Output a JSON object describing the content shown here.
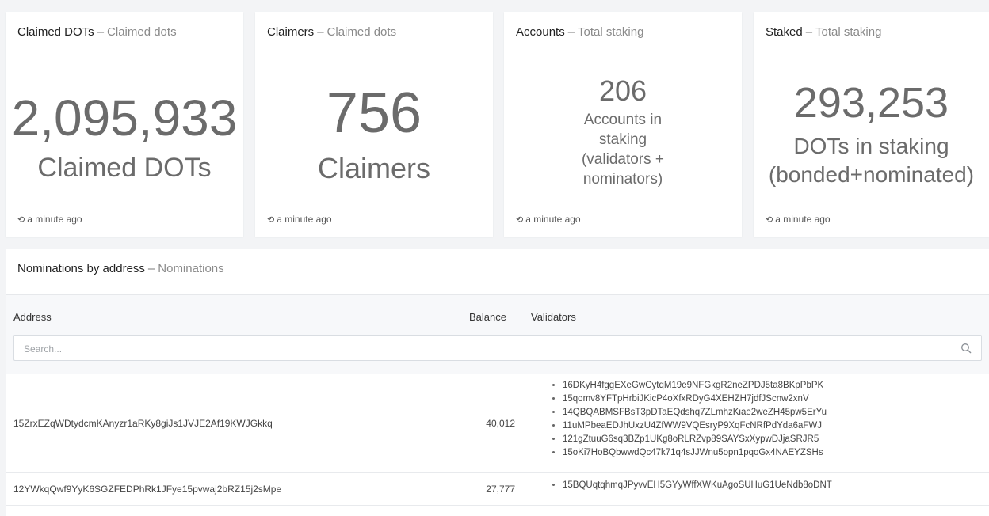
{
  "cards": [
    {
      "title": "Claimed DOTs",
      "subtitle": "Claimed dots",
      "value": "2,095,933",
      "label_lines": [
        "Claimed DOTs"
      ],
      "timestamp": "a minute ago"
    },
    {
      "title": "Claimers",
      "subtitle": "Claimed dots",
      "value": "756",
      "label_lines": [
        "Claimers"
      ],
      "timestamp": "a minute ago"
    },
    {
      "title": "Accounts",
      "subtitle": "Total staking",
      "value": "206",
      "label_lines": [
        "Accounts in",
        "staking",
        "(validators +",
        "nominators)"
      ],
      "timestamp": "a minute ago"
    },
    {
      "title": "Staked",
      "subtitle": "Total staking",
      "value": "293,253",
      "label_lines": [
        "DOTs in staking",
        "(bonded+nominated)"
      ],
      "timestamp": "a minute ago"
    }
  ],
  "nominations": {
    "title": "Nominations by address",
    "subtitle": "Nominations",
    "columns": {
      "address": "Address",
      "balance": "Balance",
      "validators": "Validators"
    },
    "search_placeholder": "Search...",
    "rows": [
      {
        "address": "15ZrxEZqWDtydcmKAnyzr1aRKy8giJs1JVJE2Af19KWJGkkq",
        "balance": "40,012",
        "validators": [
          "16DKyH4fggEXeGwCytqM19e9NFGkgR2neZPDJ5ta8BKpPbPK",
          "15qomv8YFTpHrbiJKicP4oXfxRDyG4XEHZH7jdfJScnw2xnV",
          "14QBQABMSFBsT3pDTaEQdshq7ZLmhzKiae2weZH45pw5ErYu",
          "11uMPbeaEDJhUxzU4ZfWW9VQEsryP9XqFcNRfPdYda6aFWJ",
          "121gZtuuG6sq3BZp1UKg8oRLRZvp89SAYSxXypwDJjaSRJR5",
          "15oKi7HoBQbwwdQc47k71q4sJJWnu5opn1pqoGx4NAEYZSHs"
        ]
      },
      {
        "address": "12YWkqQwf9YyK6SGZFEDPhRk1JFye15pvwaj2bRZ15j2sMpe",
        "balance": "27,777",
        "validators": [
          "15BQUqtqhmqJPyvvEH5GYyWffXWKuAgoSUHuG1UeNdb8oDNT"
        ]
      }
    ]
  },
  "icons": {
    "timestamp": "history-icon",
    "search": "search-icon"
  }
}
